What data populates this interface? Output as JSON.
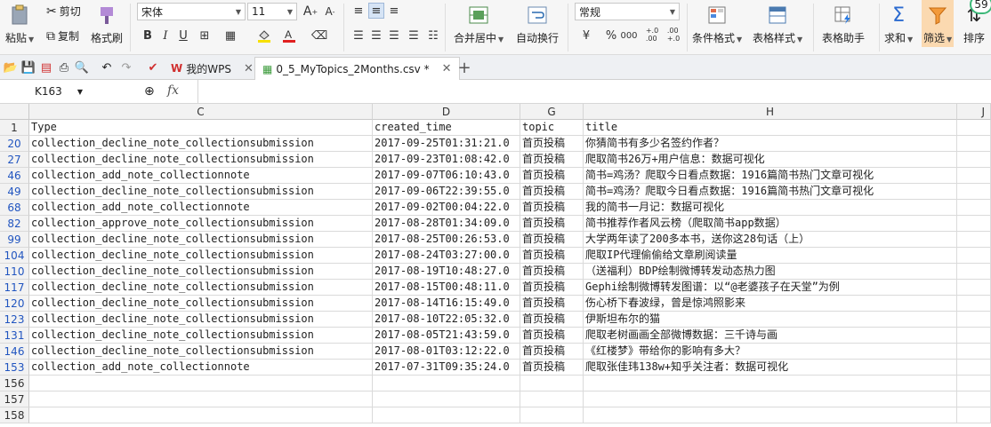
{
  "ribbon": {
    "paste": "粘贴",
    "cut": "剪切",
    "copy": "复制",
    "format_painter": "格式刷",
    "font_name": "宋体",
    "font_size": "11",
    "merge_center": "合并居中",
    "auto_wrap": "自动换行",
    "number_format": "常规",
    "percent": "%",
    "thousands": "000",
    "dec_inc": "+.0\n.00",
    "cond_format": "条件格式",
    "table_style": "表格样式",
    "table_helper": "表格助手",
    "sum": "求和",
    "filter": "筛选",
    "sort": "排序",
    "badge": "59"
  },
  "tabs": {
    "wps_tab": "我的WPS",
    "file_tab": "0_5_MyTopics_2Months.csv *"
  },
  "formula_bar": {
    "cell_ref": "K163",
    "fx": "fx",
    "content": ""
  },
  "columns": [
    "C",
    "D",
    "G",
    "H",
    "J"
  ],
  "header_row": {
    "num": "1",
    "cells": [
      "Type",
      "created_time",
      "topic",
      "title"
    ]
  },
  "rows": [
    {
      "num": "20",
      "type": "collection_decline_note_collectionsubmission",
      "time": "2017-09-25T01:31:21.0",
      "topic": "首页投稿",
      "title": "你猜简书有多少名签约作者？"
    },
    {
      "num": "27",
      "type": "collection_decline_note_collectionsubmission",
      "time": "2017-09-23T01:08:42.0",
      "topic": "首页投稿",
      "title": "爬取简书26万+用户信息：数据可视化"
    },
    {
      "num": "46",
      "type": "collection_add_note_collectionnote",
      "time": "2017-09-07T06:10:43.0",
      "topic": "首页投稿",
      "title": "简书=鸡汤？爬取今日看点数据：1916篇简书热门文章可视化"
    },
    {
      "num": "49",
      "type": "collection_decline_note_collectionsubmission",
      "time": "2017-09-06T22:39:55.0",
      "topic": "首页投稿",
      "title": "简书=鸡汤？爬取今日看点数据：1916篇简书热门文章可视化"
    },
    {
      "num": "68",
      "type": "collection_add_note_collectionnote",
      "time": "2017-09-02T00:04:22.0",
      "topic": "首页投稿",
      "title": "我的简书一月记：数据可视化"
    },
    {
      "num": "82",
      "type": "collection_approve_note_collectionsubmission",
      "time": "2017-08-28T01:34:09.0",
      "topic": "首页投稿",
      "title": "简书推荐作者风云榜（爬取简书app数据）"
    },
    {
      "num": "99",
      "type": "collection_decline_note_collectionsubmission",
      "time": "2017-08-25T00:26:53.0",
      "topic": "首页投稿",
      "title": "大学两年读了200多本书，送你这28句话（上）"
    },
    {
      "num": "104",
      "type": "collection_decline_note_collectionsubmission",
      "time": "2017-08-24T03:27:00.0",
      "topic": "首页投稿",
      "title": "爬取IP代理偷偷给文章刷阅读量"
    },
    {
      "num": "110",
      "type": "collection_decline_note_collectionsubmission",
      "time": "2017-08-19T10:48:27.0",
      "topic": "首页投稿",
      "title": "（送福利）BDP绘制微博转发动态热力图"
    },
    {
      "num": "117",
      "type": "collection_decline_note_collectionsubmission",
      "time": "2017-08-15T00:48:11.0",
      "topic": "首页投稿",
      "title": "Gephi绘制微博转发图谱：以“@老婆孩子在天堂”为例"
    },
    {
      "num": "120",
      "type": "collection_decline_note_collectionsubmission",
      "time": "2017-08-14T16:15:49.0",
      "topic": "首页投稿",
      "title": "伤心桥下春波绿，曾是惊鸿照影来"
    },
    {
      "num": "123",
      "type": "collection_decline_note_collectionsubmission",
      "time": "2017-08-10T22:05:32.0",
      "topic": "首页投稿",
      "title": "伊斯坦布尔的猫"
    },
    {
      "num": "131",
      "type": "collection_decline_note_collectionsubmission",
      "time": "2017-08-05T21:43:59.0",
      "topic": "首页投稿",
      "title": "爬取老树画画全部微博数据：三千诗与画"
    },
    {
      "num": "146",
      "type": "collection_decline_note_collectionsubmission",
      "time": "2017-08-01T03:12:22.0",
      "topic": "首页投稿",
      "title": "《红楼梦》带给你的影响有多大？"
    },
    {
      "num": "153",
      "type": "collection_add_note_collectionnote",
      "time": "2017-07-31T09:35:24.0",
      "topic": "首页投稿",
      "title": "爬取张佳玮138w+知乎关注者：数据可视化"
    }
  ],
  "empty_rows": [
    "156",
    "157",
    "158"
  ]
}
